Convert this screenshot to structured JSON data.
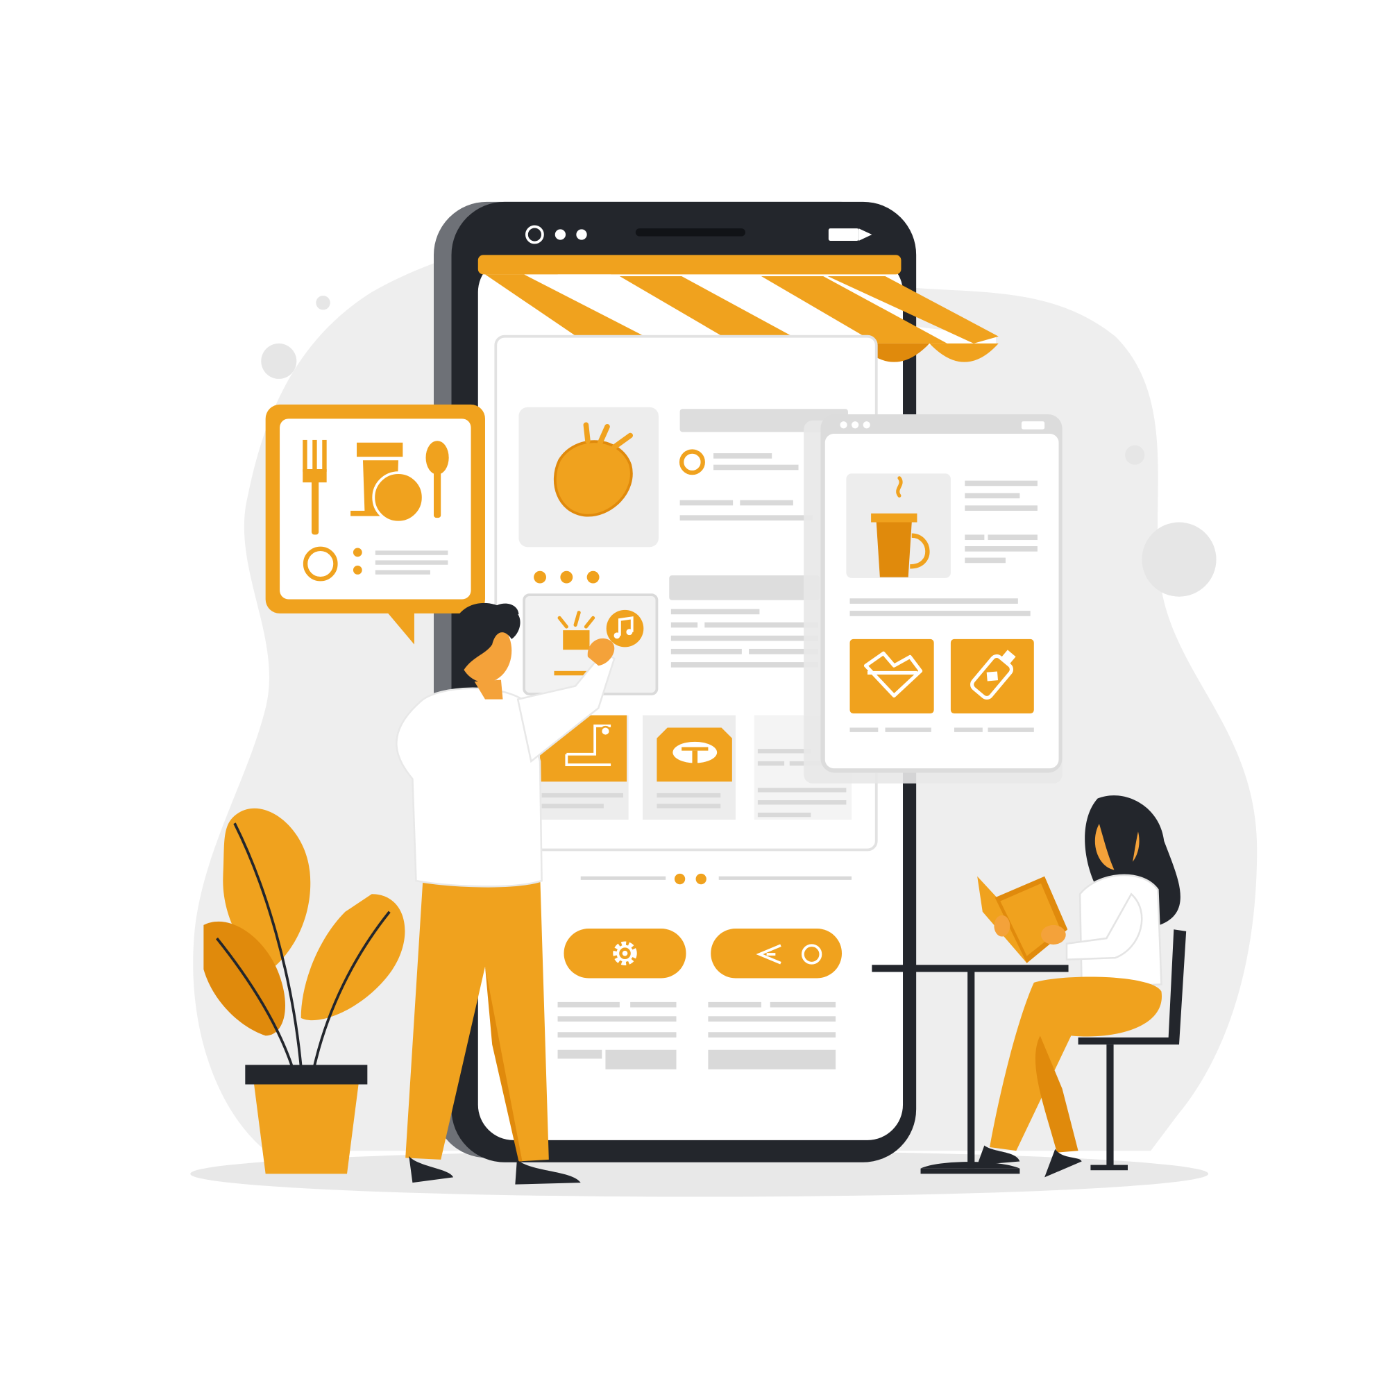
{
  "colors": {
    "accent": "#F0A21E",
    "accent_dark": "#E08A0C",
    "ink": "#23262C",
    "phone_side": "#6E7177",
    "skeleton": "#D9D9D9",
    "card_bg": "#EDEDED",
    "blob": "#EEEEEE",
    "white": "#FFFFFF",
    "skin": "#F4A23A"
  },
  "icons": {
    "menu_card": [
      "fork-icon",
      "cup-icon",
      "plate-icon",
      "spoon-icon",
      "radio-icon"
    ],
    "phone": [
      "croissant-icon",
      "music-note-icon",
      "drink-icon",
      "gear-icon",
      "share-icon"
    ],
    "detail_panel": [
      "coffee-cup-icon",
      "sandwich-icon",
      "bottle-icon"
    ]
  }
}
